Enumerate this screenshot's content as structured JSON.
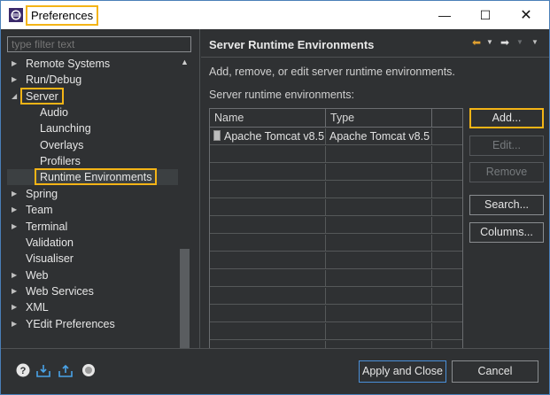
{
  "window": {
    "title": "Preferences",
    "minimize": "—",
    "maximize": "☐",
    "close": "✕"
  },
  "left": {
    "filter_placeholder": "type filter text",
    "tree": [
      {
        "label": "Remote Systems",
        "level": 0,
        "arrow": "▶"
      },
      {
        "label": "Run/Debug",
        "level": 0,
        "arrow": "▶"
      },
      {
        "label": "Server",
        "level": 0,
        "arrow": "◢",
        "highlighted": true
      },
      {
        "label": "Audio",
        "level": 1,
        "arrow": ""
      },
      {
        "label": "Launching",
        "level": 1,
        "arrow": ""
      },
      {
        "label": "Overlays",
        "level": 1,
        "arrow": ""
      },
      {
        "label": "Profilers",
        "level": 1,
        "arrow": ""
      },
      {
        "label": "Runtime Environments",
        "level": 1,
        "arrow": "",
        "selected": true,
        "highlighted": true
      },
      {
        "label": "Spring",
        "level": 0,
        "arrow": "▶"
      },
      {
        "label": "Team",
        "level": 0,
        "arrow": "▶"
      },
      {
        "label": "Terminal",
        "level": 0,
        "arrow": "▶"
      },
      {
        "label": "Validation",
        "level": 0,
        "arrow": ""
      },
      {
        "label": "Visualiser",
        "level": 0,
        "arrow": ""
      },
      {
        "label": "Web",
        "level": 0,
        "arrow": "▶"
      },
      {
        "label": "Web Services",
        "level": 0,
        "arrow": "▶"
      },
      {
        "label": "XML",
        "level": 0,
        "arrow": "▶"
      },
      {
        "label": "YEdit Preferences",
        "level": 0,
        "arrow": "▶"
      }
    ]
  },
  "right": {
    "title": "Server Runtime Environments",
    "description": "Add, remove, or edit server runtime environments.",
    "table_label": "Server runtime environments:",
    "columns": [
      "Name",
      "Type"
    ],
    "rows": [
      {
        "name": "Apache Tomcat v8.5",
        "type": "Apache Tomcat v8.5"
      }
    ],
    "buttons": {
      "add": "Add...",
      "edit": "Edit...",
      "remove": "Remove",
      "search": "Search...",
      "columns": "Columns..."
    }
  },
  "footer": {
    "apply_close": "Apply and Close",
    "cancel": "Cancel"
  },
  "colors": {
    "background": "#2f3133",
    "highlight": "#f4b416",
    "primary_border": "#4a90d9"
  }
}
